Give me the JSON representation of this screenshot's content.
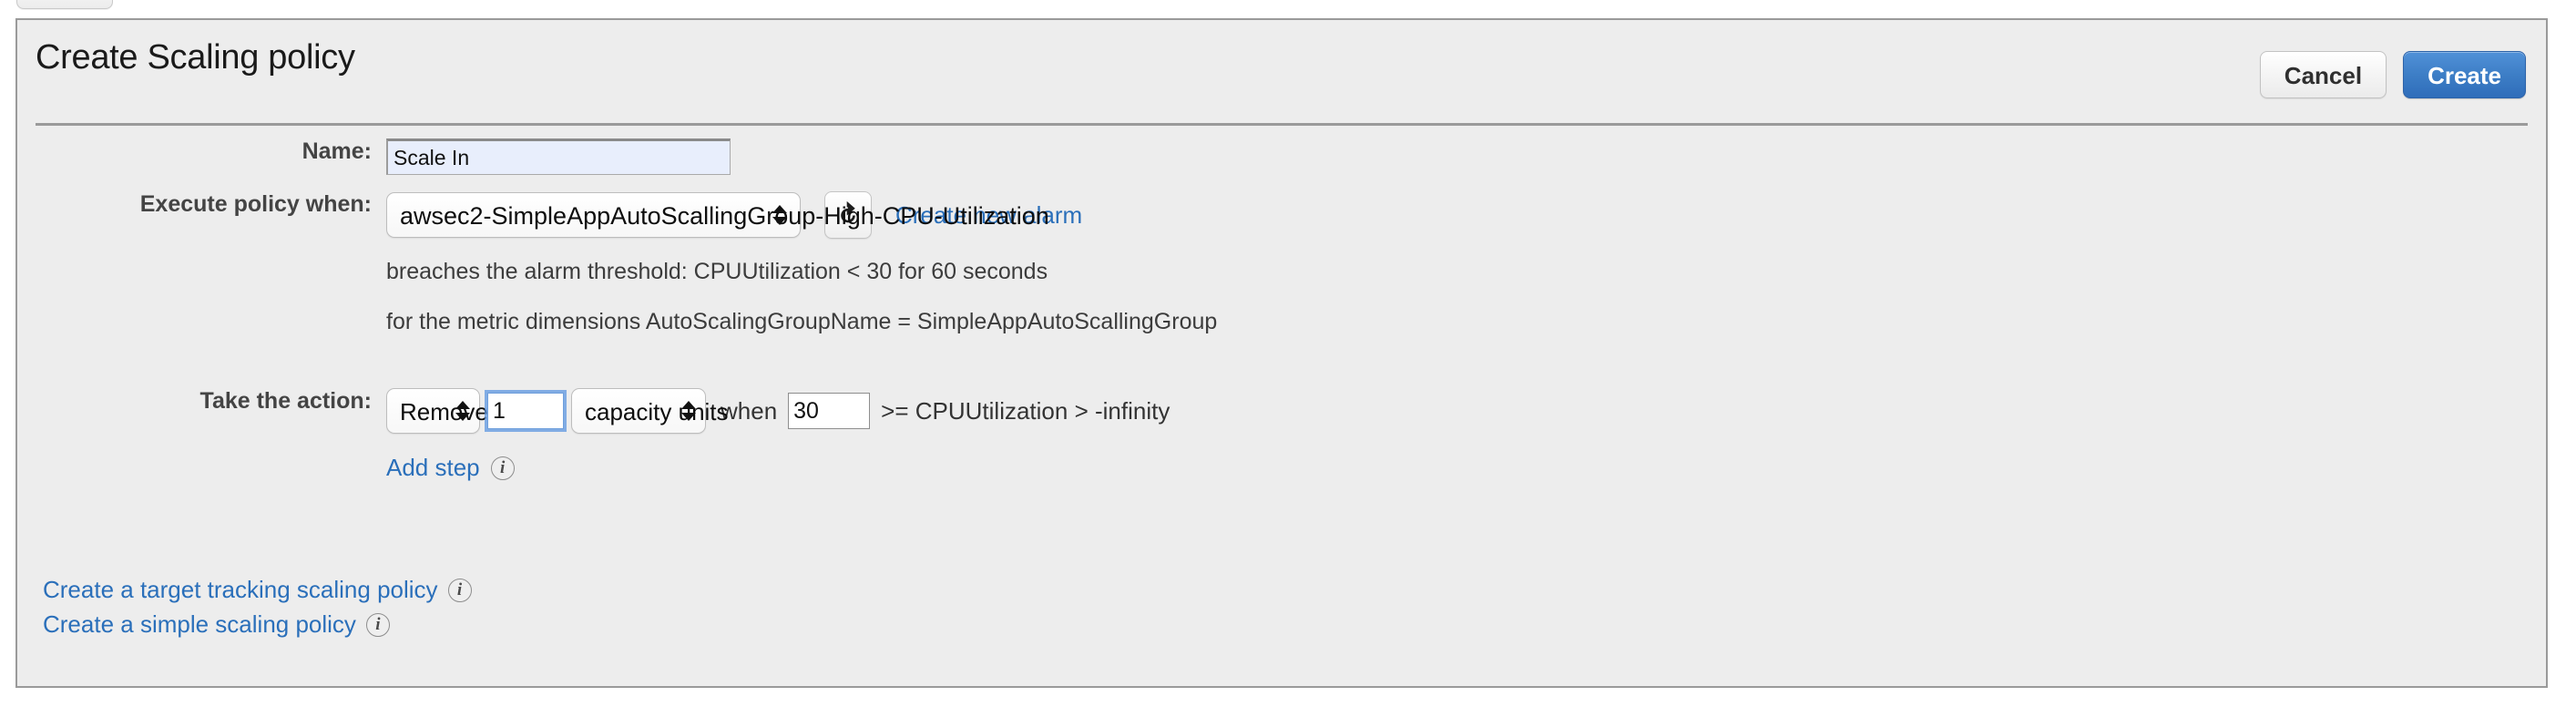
{
  "panel": {
    "title": "Create Scaling policy",
    "cancel_label": "Cancel",
    "create_label": "Create"
  },
  "form": {
    "name": {
      "label": "Name:",
      "value": "Scale In",
      "placeholder": ""
    },
    "execute_policy_when": {
      "label": "Execute policy when:",
      "alarm_selected": "awsec2-SimpleAppAutoScallingGroup-High-CPU-Utilization",
      "refresh_icon": "refresh-icon",
      "create_alarm_link": "Create new alarm",
      "breach_line": "breaches the alarm threshold: CPUUtilization < 30 for 60 seconds",
      "dimensions_line": "for the metric dimensions AutoScalingGroupName = SimpleAppAutoScallingGroup"
    },
    "take_the_action": {
      "label": "Take the action:",
      "action_selected": "Remove",
      "amount_value": "1",
      "units_selected": "capacity units",
      "when_word": "when",
      "threshold_value": "30",
      "condition_text": ">= CPUUtilization > -infinity",
      "add_step_label": "Add step",
      "add_step_info_icon": "info-icon"
    }
  },
  "bottom_links": [
    {
      "label": "Create a target tracking scaling policy",
      "icon": "info-icon"
    },
    {
      "label": "Create a simple scaling policy",
      "icon": "info-icon"
    }
  ],
  "colors": {
    "panel_bg": "#ededed",
    "link_blue": "#2a6fba",
    "primary_button": "#3d7ec6",
    "autofill_field": "#e8eefc",
    "focus_ring": "#5c95e0"
  }
}
